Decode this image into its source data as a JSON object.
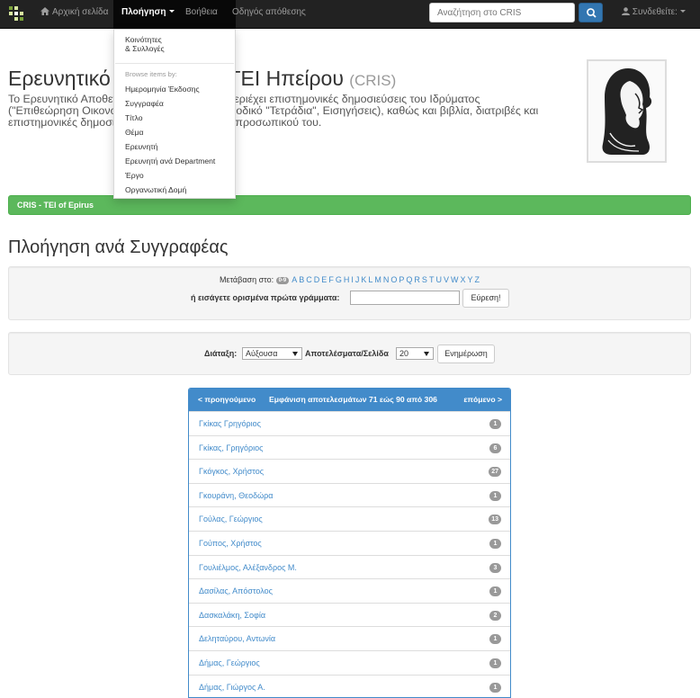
{
  "nav": {
    "home": "Αρχική σελίδα",
    "browse": "Πλοήγηση",
    "help": "Βοήθεια",
    "guide": "Οδηγός απόθεσης",
    "search_placeholder": "Αναζήτηση στο CRIS",
    "signin": "Συνδεθείτε:"
  },
  "dropdown": {
    "communities_line1": "Κοινότητες",
    "communities_line2": "& Συλλογές",
    "header": "Browse items by:",
    "items": [
      "Ημερομηνία Έκδοσης",
      "Συγγραφέα",
      "Τίτλο",
      "Θέμα",
      "Ερευνητή",
      "Ερευνητή ανά Department",
      "Έργο",
      "Οργανωτική Δομή"
    ]
  },
  "hero": {
    "title_main": "Ερευνητικό Αποθετήριο ΤΕΙ Ηπείρου",
    "title_small": "(CRIS)",
    "lines": [
      "Το Ερευνητικό Αποθετήριο του ΤΕΙ Ηπείρου περιέχει επιστημονικές δημοσιεύσεις του Ιδρύματος",
      "(\"Επιθεώρηση Οικονομικών Επιστημών\", Περιοδικό \"Τετράδια\", Εισηγήσεις), καθώς και βιβλία, διατριβές και",
      "επιστημονικές δημοσιεύσεις του ακαδημαϊκού προσωπικού του."
    ]
  },
  "breadcrumb": "CRIS - TEI of Epirus",
  "page_title": "Πλοήγηση ανά Συγγραφέας",
  "jump": {
    "label": "Μετάβαση στο:",
    "digits": "0-9",
    "letters": [
      "A",
      "B",
      "C",
      "D",
      "E",
      "F",
      "G",
      "H",
      "I",
      "J",
      "K",
      "L",
      "M",
      "N",
      "O",
      "P",
      "Q",
      "R",
      "S",
      "T",
      "U",
      "V",
      "W",
      "X",
      "Y",
      "Z"
    ],
    "enter_label": "ή εισάγετε ορισμένα πρώτα γράμματα:",
    "go_button": "Εύρεση!"
  },
  "sort": {
    "label": "Διάταξη:",
    "order_value": "Αύξουσα",
    "rpp_label": "Αποτελέσματα/Σελίδα",
    "rpp_value": "20",
    "update_button": "Ενημέρωση"
  },
  "results": {
    "prev": "< προηγούμενο",
    "summary": "Εμφάνιση αποτελεσμάτων 71 εώς 90 από 306",
    "next": "επόμενο >",
    "rows": [
      {
        "name": "Γκίκας Γρηγόριος",
        "count": "1"
      },
      {
        "name": "Γκίκας, Γρηγόριος",
        "count": "6"
      },
      {
        "name": "Γκόγκος, Χρήστος",
        "count": "27"
      },
      {
        "name": "Γκουράνη, Θεοδώρα",
        "count": "1"
      },
      {
        "name": "Γούλας, Γεώργιος",
        "count": "13"
      },
      {
        "name": "Γούπος, Χρήστος",
        "count": "1"
      },
      {
        "name": "Γουλιέλμος, Αλέξανδρος Μ.",
        "count": "3"
      },
      {
        "name": "Δασίλας, Απόστολος",
        "count": "1"
      },
      {
        "name": "Δασκαλάκη, Σοφία",
        "count": "2"
      },
      {
        "name": "Δεληταύρου, Αντωνία",
        "count": "1"
      },
      {
        "name": "Δήμας, Γεώργιος",
        "count": "1"
      },
      {
        "name": "Δήμας, Γιώργος Α.",
        "count": "1"
      }
    ]
  }
}
